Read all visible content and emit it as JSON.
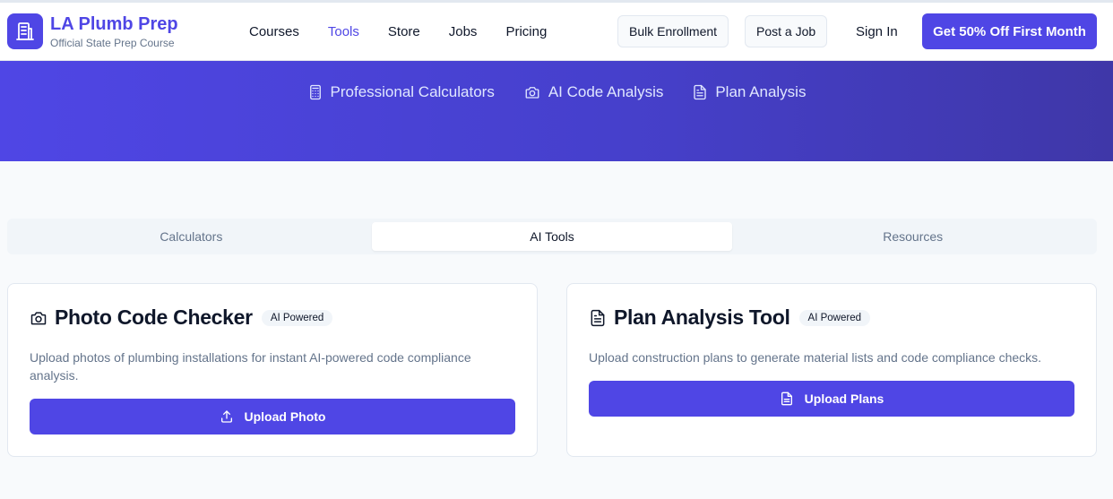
{
  "brand": {
    "name": "LA Plumb Prep",
    "subtitle": "Official State Prep Course"
  },
  "nav": [
    {
      "label": "Courses",
      "active": false
    },
    {
      "label": "Tools",
      "active": true
    },
    {
      "label": "Store",
      "active": false
    },
    {
      "label": "Jobs",
      "active": false
    },
    {
      "label": "Pricing",
      "active": false
    }
  ],
  "header_actions": {
    "bulk_enrollment": "Bulk Enrollment",
    "post_job": "Post a Job",
    "sign_in": "Sign In",
    "cta": "Get 50% Off First Month"
  },
  "hero_tabs": [
    {
      "label": "Professional Calculators",
      "icon": "calculator-icon"
    },
    {
      "label": "AI Code Analysis",
      "icon": "camera-icon"
    },
    {
      "label": "Plan Analysis",
      "icon": "document-icon"
    }
  ],
  "tabs": [
    {
      "label": "Calculators",
      "active": false
    },
    {
      "label": "AI Tools",
      "active": true
    },
    {
      "label": "Resources",
      "active": false
    }
  ],
  "cards": [
    {
      "title": "Photo Code Checker",
      "badge": "AI Powered",
      "icon": "camera-icon",
      "description": "Upload photos of plumbing installations for instant AI-powered code compliance analysis.",
      "button": "Upload Photo",
      "button_icon": "upload-icon"
    },
    {
      "title": "Plan Analysis Tool",
      "badge": "AI Powered",
      "icon": "document-icon",
      "description": "Upload construction plans to generate material lists and code compliance checks.",
      "button": "Upload Plans",
      "button_icon": "document-icon"
    }
  ],
  "colors": {
    "primary": "#4f46e5",
    "muted_text": "#64748b",
    "background": "#f8fafc"
  }
}
